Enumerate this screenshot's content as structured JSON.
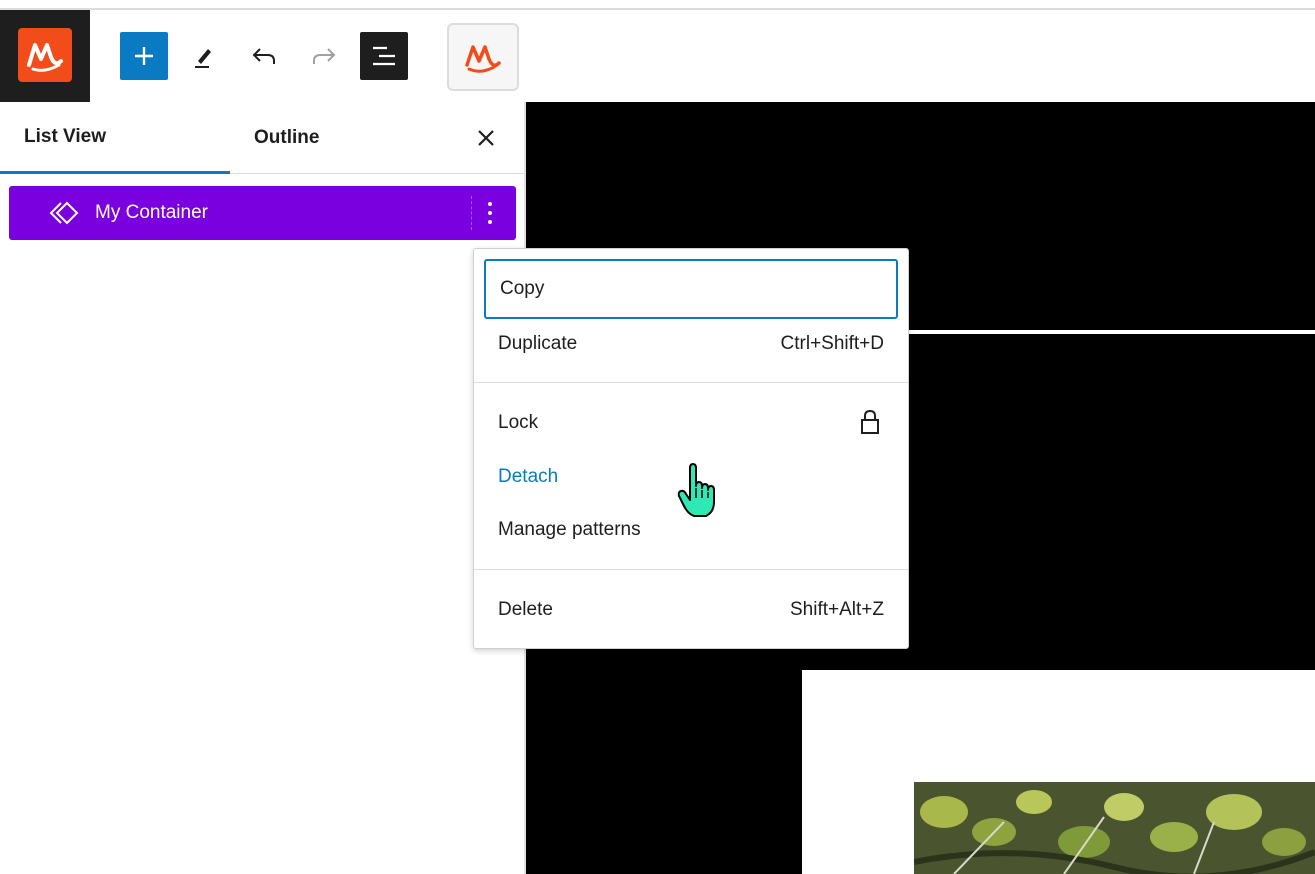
{
  "toolbar": {
    "site_logo": "site-logo-icon",
    "add_button_icon": "plus-icon",
    "tools_icon": "pencil-icon",
    "undo_icon": "undo-icon",
    "redo_icon": "redo-icon",
    "list_view_icon": "list-view-icon",
    "pattern_icon": "pattern-logo-icon",
    "accent_color": "#0a7bc2",
    "logo_color": "#f24c1a"
  },
  "sidebar": {
    "tabs": [
      {
        "label": "List View",
        "active": true
      },
      {
        "label": "Outline",
        "active": false
      }
    ],
    "close_icon": "close-icon",
    "tree": {
      "label": "My Container",
      "icon": "synced-pattern-icon",
      "selected_color": "#7b00e0"
    }
  },
  "menu": {
    "items": [
      {
        "label": "Copy",
        "shortcut": "",
        "focused": true
      },
      {
        "label": "Duplicate",
        "shortcut": "Ctrl+Shift+D"
      },
      {
        "label": "Lock",
        "icon": "lock-icon"
      },
      {
        "label": "Detach",
        "highlight_color": "#0a7bc2"
      },
      {
        "label": "Manage patterns"
      },
      {
        "label": "Delete",
        "shortcut": "Shift+Alt+Z"
      }
    ]
  }
}
